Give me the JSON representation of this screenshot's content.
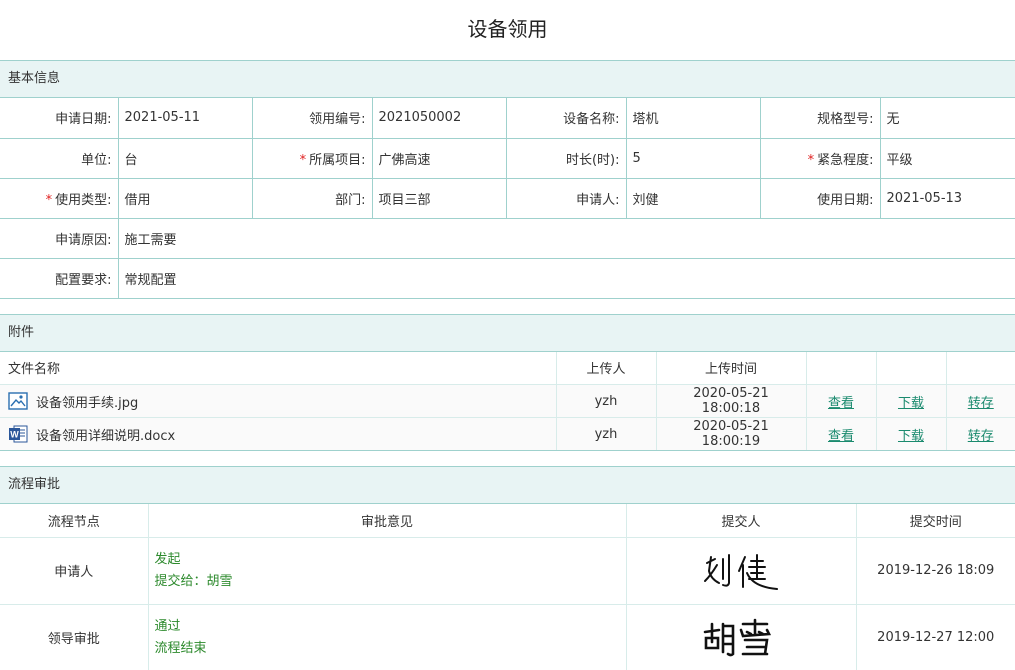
{
  "page": {
    "title": "设备领用"
  },
  "basic": {
    "heading": "基本信息",
    "apply_date_label": "申请日期:",
    "apply_date": "2021-05-11",
    "code_label": "领用编号:",
    "code": "2021050002",
    "device_label": "设备名称:",
    "device": "塔机",
    "spec_label": "规格型号:",
    "spec": "无",
    "unit_label": "单位:",
    "unit": "台",
    "project_label": "所属项目:",
    "project": "广佛高速",
    "duration_label": "时长(时):",
    "duration": "5",
    "urgency_label": "紧急程度:",
    "urgency": "平级",
    "use_type_label": "使用类型:",
    "use_type": "借用",
    "dept_label": "部门:",
    "dept": "项目三部",
    "applicant_label": "申请人:",
    "applicant": "刘健",
    "use_date_label": "使用日期:",
    "use_date": "2021-05-13",
    "reason_label": "申请原因:",
    "reason": "施工需要",
    "config_label": "配置要求:",
    "config": "常规配置",
    "required_mark": "*"
  },
  "attachments": {
    "heading": "附件",
    "headers": {
      "name": "文件名称",
      "uploader": "上传人",
      "time": "上传时间"
    },
    "files": [
      {
        "name": "设备领用手续.jpg",
        "icon": "image-file-icon",
        "uploader": "yzh",
        "time": "2020-05-21 18:00:18",
        "view": "查看",
        "download": "下载",
        "save": "转存"
      },
      {
        "name": "设备领用详细说明.docx",
        "icon": "word-file-icon",
        "uploader": "yzh",
        "time": "2020-05-21 18:00:19",
        "view": "查看",
        "download": "下载",
        "save": "转存"
      }
    ]
  },
  "flow": {
    "heading": "流程审批",
    "headers": {
      "node": "流程节点",
      "opinion": "审批意见",
      "submitter": "提交人",
      "time": "提交时间"
    },
    "steps": [
      {
        "node": "申请人",
        "opinion_1": "发起",
        "opinion_2": "提交给：胡雪",
        "signature": "刘健",
        "time": "2019-12-26 18:09"
      },
      {
        "node": "领导审批",
        "opinion_1": "通过",
        "opinion_2": "流程结束",
        "signature": "胡雪",
        "time": "2019-12-27 12:00"
      }
    ]
  },
  "colors": {
    "border": "#9fd1cd",
    "section_bg": "#e8f4f4",
    "link": "#1a8a6e",
    "opinion": "#2d8a2d",
    "required": "#e02020"
  }
}
